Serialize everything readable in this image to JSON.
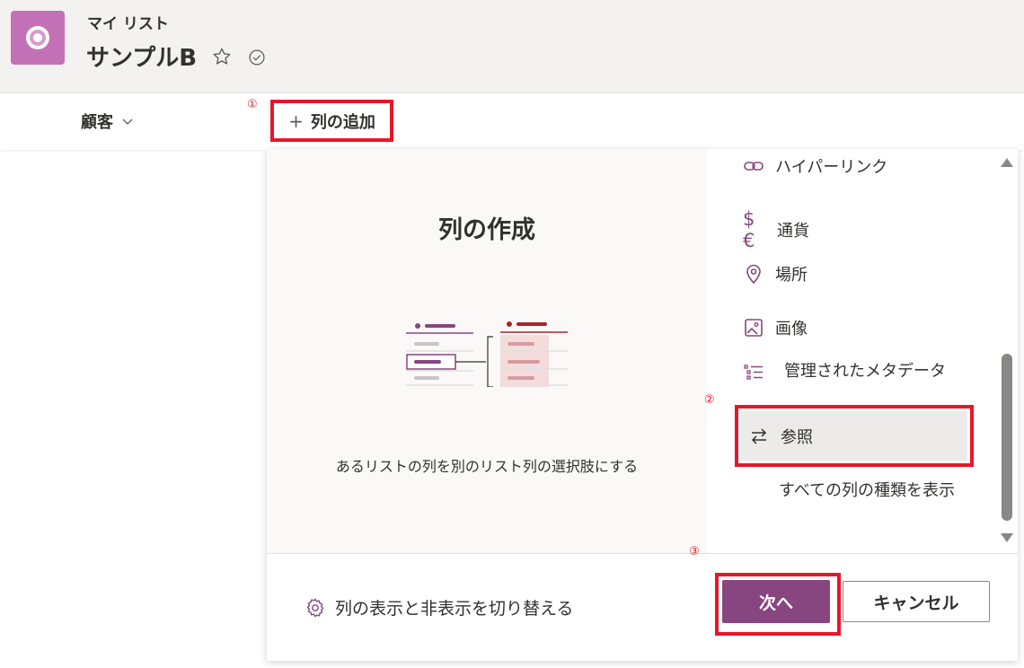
{
  "header": {
    "site_name": "マイ リスト",
    "list_title": "サンプルB"
  },
  "toolbar": {
    "column_header": "顧客",
    "add_column_label": "列の追加",
    "markers": [
      "①",
      "②",
      "③"
    ]
  },
  "panel": {
    "title": "列の作成",
    "description": "あるリストの列を別のリスト列の選択肢にする",
    "column_types": [
      {
        "label": "ハイパーリンク",
        "icon": "link-icon"
      },
      {
        "label": "通貨",
        "icon": "currency-icon"
      },
      {
        "label": "場所",
        "icon": "location-icon"
      },
      {
        "label": "画像",
        "icon": "image-icon"
      },
      {
        "label": "管理されたメタデータ",
        "icon": "metadata-icon"
      },
      {
        "label": "参照",
        "icon": "lookup-icon"
      }
    ],
    "selected_type": "参照",
    "show_all_label": "すべての列の種類を表示",
    "toggle_columns_label": "列の表示と非表示を切り替える",
    "next_label": "次へ",
    "cancel_label": "キャンセル"
  },
  "colors": {
    "accent": "#884681",
    "highlight_border": "#e8162b",
    "app_icon": "#c371b7"
  }
}
